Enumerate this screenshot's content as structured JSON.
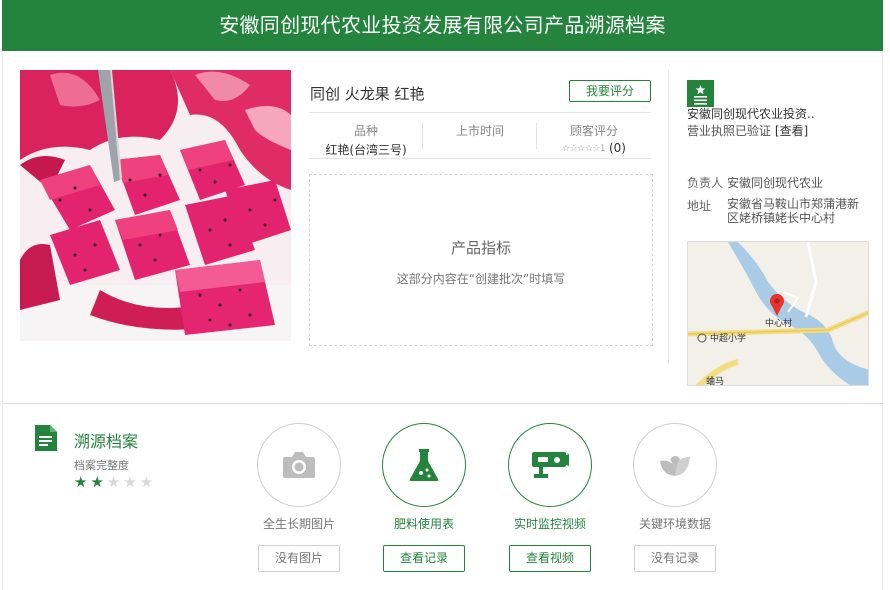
{
  "header": {
    "title": "安徽同创现代农业投资发展有限公司产品溯源档案"
  },
  "product": {
    "name": "同创 火龙果 红艳",
    "rate_button": "我要评分",
    "attributes": {
      "variety_label": "品种",
      "variety_value": "红艳(台湾三号)",
      "market_label": "上市时间",
      "market_value": "",
      "rating_label": "顾客评分",
      "rating_stars": "☆☆☆☆☆1",
      "rating_count": "(0)"
    },
    "spec": {
      "title": "产品指标",
      "note": "这部分内容在“创建批次”时填写"
    }
  },
  "company": {
    "icon": "star-document-icon",
    "name": "安徽同创现代农业投资..",
    "license_text": "营业执照已验证",
    "license_link": "[查看]",
    "person_label": "负责人",
    "person_value": "安徽同创现代农业",
    "address_label": "地址",
    "address_value": "安徽省马鞍山市郑蒲港新区姥桥镇姥长中心村"
  },
  "map": {
    "marker_label": "中心村",
    "road_label": "中超小学",
    "corner_label": "蛐马"
  },
  "trace": {
    "icon": "document-icon",
    "title": "溯源档案",
    "completeness_label": "档案完整度",
    "stars_on": "★★",
    "stars_off": "★★★",
    "completeness_value": 2,
    "completeness_max": 5
  },
  "features": [
    {
      "icon": "camera-icon",
      "label": "全生长期图片",
      "button": "没有图片",
      "active": false
    },
    {
      "icon": "flask-icon",
      "label": "肥料使用表",
      "button": "查看记录",
      "active": true
    },
    {
      "icon": "surveillance-camera-icon",
      "label": "实时监控视频",
      "button": "查看视频",
      "active": true
    },
    {
      "icon": "leaf-icon",
      "label": "关键环境数据",
      "button": "没有记录",
      "active": false
    }
  ],
  "colors": {
    "brand": "#24843e",
    "inactive": "#bdbdbd"
  }
}
